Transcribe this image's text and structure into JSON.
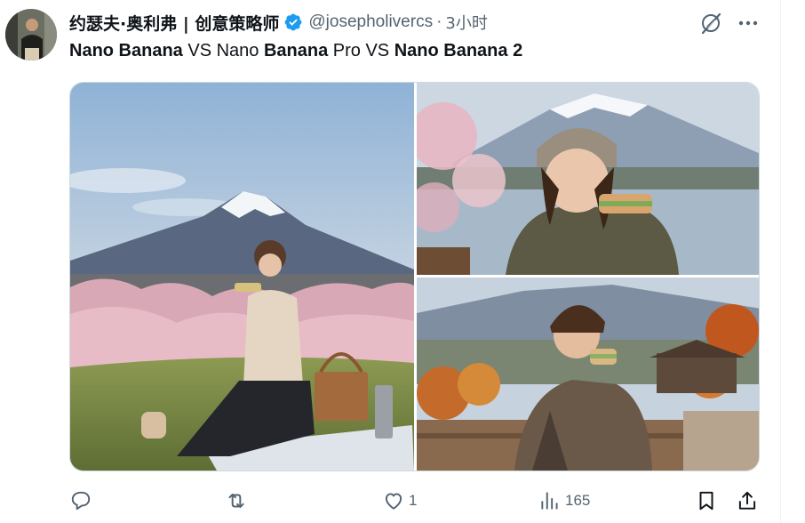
{
  "author": {
    "display_name": "约瑟夫·奥利弗 | 创意策略师",
    "handle": "@josepholivercs",
    "separator": "·",
    "time": "3小时",
    "verified": true
  },
  "tweet": {
    "segments": [
      {
        "text": "Nano Banana",
        "bold": true
      },
      {
        "text": " VS Nano ",
        "bold": false
      },
      {
        "text": "Banana",
        "bold": true
      },
      {
        "text": " Pro VS ",
        "bold": false
      },
      {
        "text": "Nano Banana 2",
        "bold": true
      }
    ]
  },
  "media": {
    "count": 3,
    "images": [
      {
        "icon": "photo-woman-picnic-fuji"
      },
      {
        "icon": "photo-woman-beanie-lake-fuji"
      },
      {
        "icon": "photo-woman-plaid-bench-fuji"
      }
    ]
  },
  "actions": {
    "reply_count": "",
    "retweet_count": "",
    "like_count": "1",
    "views_count": "165"
  },
  "colors": {
    "text": "#0f1419",
    "secondary": "#536471",
    "verified": "#1d9bf0",
    "border": "#cfd9de"
  }
}
